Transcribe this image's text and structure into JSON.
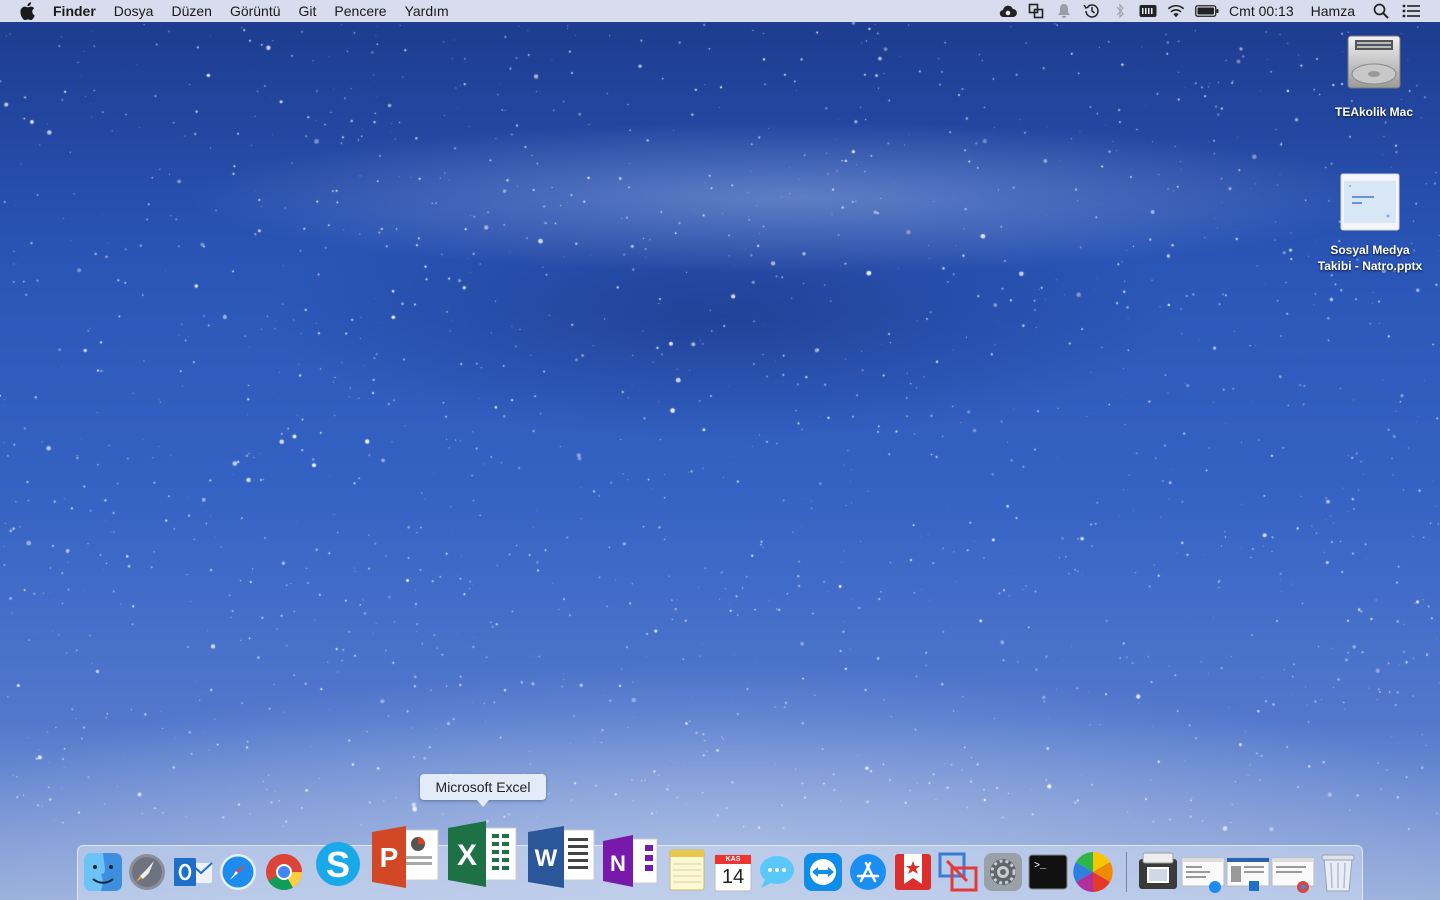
{
  "menubar": {
    "app_name": "Finder",
    "menus": [
      "Dosya",
      "Düzen",
      "Görüntü",
      "Git",
      "Pencere",
      "Yardım"
    ],
    "clock": "Cmt 00:13",
    "user": "Hamza",
    "status_icons": [
      "creative-cloud-icon",
      "sync-icon",
      "notification-bell-icon",
      "time-machine-icon",
      "bluetooth-icon",
      "keyboard-input-icon",
      "wifi-icon",
      "battery-icon"
    ]
  },
  "desktop": {
    "icons": [
      {
        "label": "TEAkolik Mac",
        "icon": "hard-drive-icon"
      },
      {
        "label_line1": "Sosyal Medya",
        "label_line2": "Takibi - Natro.pptx",
        "icon": "pptx-thumbnail-icon"
      }
    ]
  },
  "tooltip": {
    "text": "Microsoft Excel"
  },
  "dock": {
    "calendar_month": "KAS",
    "calendar_day": "14",
    "apps": [
      "Finder",
      "Launchpad",
      "Microsoft Outlook",
      "Safari",
      "Google Chrome",
      "Skype",
      "Microsoft PowerPoint",
      "Microsoft Excel",
      "Microsoft Word",
      "Microsoft OneNote",
      "Notes",
      "Calendar",
      "Messages",
      "TeamViewer",
      "App Store",
      "Wunderlist",
      "Parallels",
      "System Preferences",
      "Terminal",
      "Color Picker",
      "Image Capture",
      "Safari Window",
      "Outlook Window",
      "Chrome Window",
      "Trash"
    ]
  }
}
